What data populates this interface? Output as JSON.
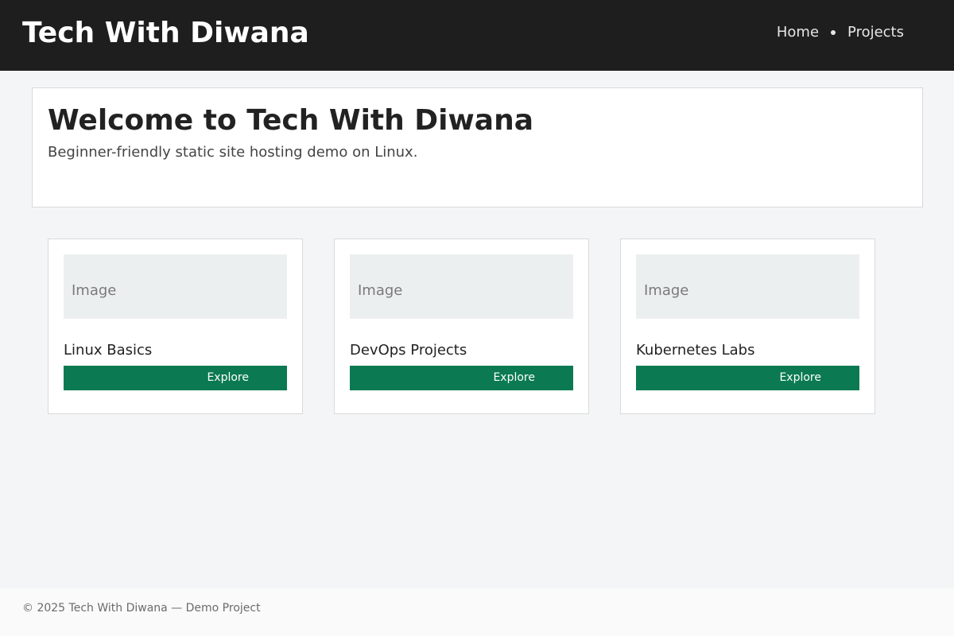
{
  "header": {
    "site_title": "Tech With Diwana",
    "nav": [
      {
        "label": "Home"
      },
      {
        "label": "Projects"
      }
    ]
  },
  "hero": {
    "title": "Welcome to Tech With Diwana",
    "subtitle": "Beginner-friendly static site hosting demo on Linux."
  },
  "cards": [
    {
      "image_label": "Image",
      "title": "Linux Basics",
      "button_label": "Explore"
    },
    {
      "image_label": "Image",
      "title": "DevOps Projects",
      "button_label": "Explore"
    },
    {
      "image_label": "Image",
      "title": "Kubernetes Labs",
      "button_label": "Explore"
    }
  ],
  "footer": {
    "text": "© 2025 Tech With Diwana — Demo Project"
  },
  "colors": {
    "header_bg": "#1e1e1e",
    "page_bg": "#f4f5f7",
    "button_bg": "#0b7a52",
    "image_placeholder_bg": "#eceff0"
  }
}
